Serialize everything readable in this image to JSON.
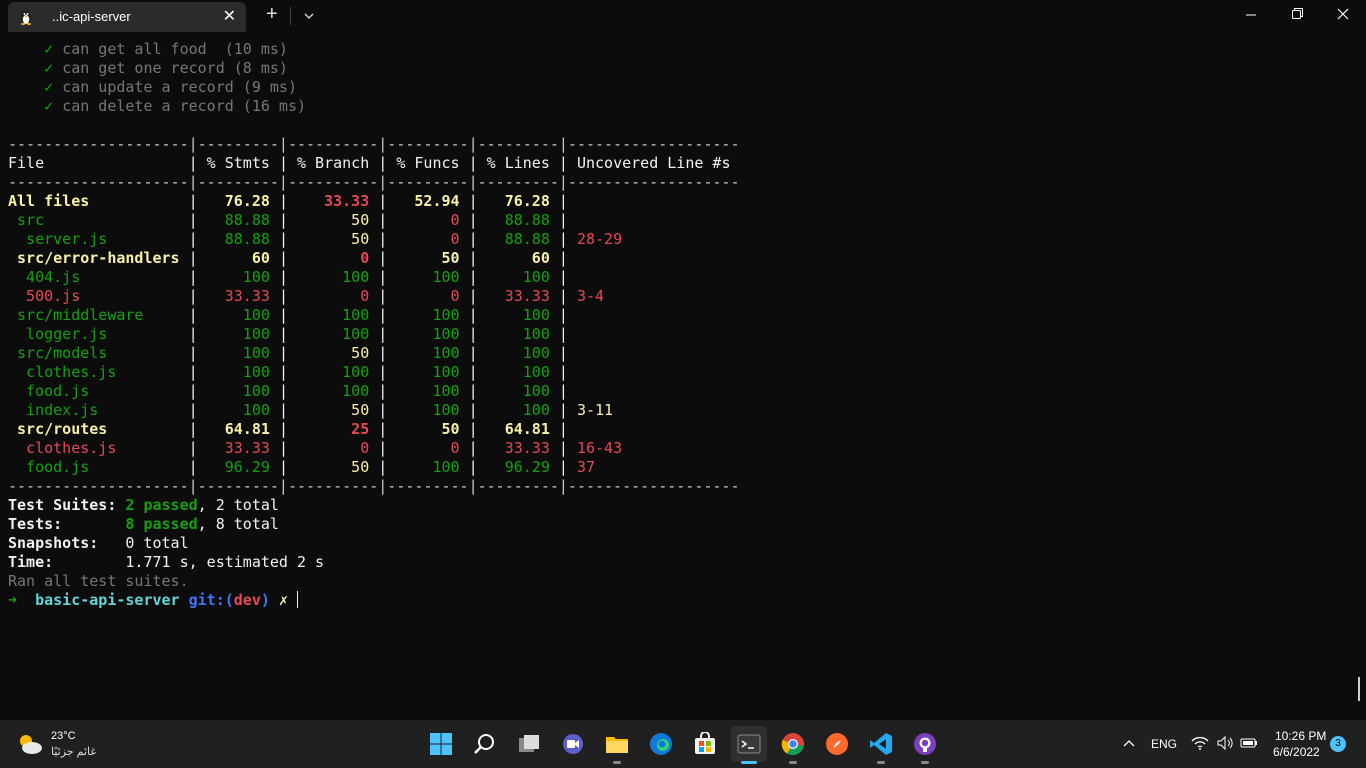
{
  "tab": {
    "title": "..ic-api-server",
    "close_glyph": "✕"
  },
  "titlebar": {
    "new_tab_glyph": "+"
  },
  "test_results": [
    {
      "mark": "✓",
      "text": "can get all food  (10 ms)"
    },
    {
      "mark": "✓",
      "text": "can get one record (8 ms)"
    },
    {
      "mark": "✓",
      "text": "can update a record (9 ms)"
    },
    {
      "mark": "✓",
      "text": "can delete a record (16 ms)"
    }
  ],
  "coverage": {
    "separator": "--------------------|---------|----------|---------|---------|-------------------",
    "headers": [
      "File",
      "% Stmts",
      "% Branch",
      "% Funcs",
      "% Lines",
      "Uncovered Line #s"
    ],
    "rows": [
      {
        "file": "All files",
        "indent": 0,
        "bold": true,
        "stmts": "76.28",
        "branch": "33.33",
        "funcs": "52.94",
        "lines": "76.28",
        "uncovered": "",
        "fc": "y",
        "sc": "y",
        "bc": "r",
        "uc": "y",
        "lc": "y",
        "ucc": "y"
      },
      {
        "file": "src",
        "indent": 1,
        "bold": false,
        "stmts": "88.88",
        "branch": "50",
        "funcs": "0",
        "lines": "88.88",
        "uncovered": "",
        "fc": "g",
        "sc": "g",
        "bc": "y",
        "uc": "r",
        "lc": "g",
        "ucc": "g"
      },
      {
        "file": "server.js",
        "indent": 2,
        "bold": false,
        "stmts": "88.88",
        "branch": "50",
        "funcs": "0",
        "lines": "88.88",
        "uncovered": "28-29",
        "fc": "g",
        "sc": "g",
        "bc": "y",
        "uc": "r",
        "lc": "g",
        "ucc": "r"
      },
      {
        "file": "src/error-handlers",
        "indent": 1,
        "bold": true,
        "stmts": "60",
        "branch": "0",
        "funcs": "50",
        "lines": "60",
        "uncovered": "",
        "fc": "y",
        "sc": "y",
        "bc": "r",
        "uc": "y",
        "lc": "y",
        "ucc": "y"
      },
      {
        "file": "404.js",
        "indent": 2,
        "bold": false,
        "stmts": "100",
        "branch": "100",
        "funcs": "100",
        "lines": "100",
        "uncovered": "",
        "fc": "g",
        "sc": "g",
        "bc": "g",
        "uc": "g",
        "lc": "g",
        "ucc": "g"
      },
      {
        "file": "500.js",
        "indent": 2,
        "bold": false,
        "stmts": "33.33",
        "branch": "0",
        "funcs": "0",
        "lines": "33.33",
        "uncovered": "3-4",
        "fc": "r",
        "sc": "r",
        "bc": "r",
        "uc": "r",
        "lc": "r",
        "ucc": "r"
      },
      {
        "file": "src/middleware",
        "indent": 1,
        "bold": false,
        "stmts": "100",
        "branch": "100",
        "funcs": "100",
        "lines": "100",
        "uncovered": "",
        "fc": "g",
        "sc": "g",
        "bc": "g",
        "uc": "g",
        "lc": "g",
        "ucc": "g"
      },
      {
        "file": "logger.js",
        "indent": 2,
        "bold": false,
        "stmts": "100",
        "branch": "100",
        "funcs": "100",
        "lines": "100",
        "uncovered": "",
        "fc": "g",
        "sc": "g",
        "bc": "g",
        "uc": "g",
        "lc": "g",
        "ucc": "g"
      },
      {
        "file": "src/models",
        "indent": 1,
        "bold": false,
        "stmts": "100",
        "branch": "50",
        "funcs": "100",
        "lines": "100",
        "uncovered": "",
        "fc": "g",
        "sc": "g",
        "bc": "y",
        "uc": "g",
        "lc": "g",
        "ucc": "g"
      },
      {
        "file": "clothes.js",
        "indent": 2,
        "bold": false,
        "stmts": "100",
        "branch": "100",
        "funcs": "100",
        "lines": "100",
        "uncovered": "",
        "fc": "g",
        "sc": "g",
        "bc": "g",
        "uc": "g",
        "lc": "g",
        "ucc": "g"
      },
      {
        "file": "food.js",
        "indent": 2,
        "bold": false,
        "stmts": "100",
        "branch": "100",
        "funcs": "100",
        "lines": "100",
        "uncovered": "",
        "fc": "g",
        "sc": "g",
        "bc": "g",
        "uc": "g",
        "lc": "g",
        "ucc": "g"
      },
      {
        "file": "index.js",
        "indent": 2,
        "bold": false,
        "stmts": "100",
        "branch": "50",
        "funcs": "100",
        "lines": "100",
        "uncovered": "3-11",
        "fc": "g",
        "sc": "g",
        "bc": "y",
        "uc": "g",
        "lc": "g",
        "ucc": "y"
      },
      {
        "file": "src/routes",
        "indent": 1,
        "bold": true,
        "stmts": "64.81",
        "branch": "25",
        "funcs": "50",
        "lines": "64.81",
        "uncovered": "",
        "fc": "y",
        "sc": "y",
        "bc": "r",
        "uc": "y",
        "lc": "y",
        "ucc": "y"
      },
      {
        "file": "clothes.js",
        "indent": 2,
        "bold": false,
        "stmts": "33.33",
        "branch": "0",
        "funcs": "0",
        "lines": "33.33",
        "uncovered": "16-43",
        "fc": "r",
        "sc": "r",
        "bc": "r",
        "uc": "r",
        "lc": "r",
        "ucc": "r"
      },
      {
        "file": "food.js",
        "indent": 2,
        "bold": false,
        "stmts": "96.29",
        "branch": "50",
        "funcs": "100",
        "lines": "96.29",
        "uncovered": "37",
        "fc": "g",
        "sc": "g",
        "bc": "y",
        "uc": "g",
        "lc": "g",
        "ucc": "r"
      }
    ]
  },
  "summary": [
    {
      "label": "Test Suites: ",
      "parts": [
        {
          "t": "2 passed",
          "c": "g"
        },
        {
          "t": ", 2 total",
          "c": "w"
        }
      ]
    },
    {
      "label": "Tests:       ",
      "parts": [
        {
          "t": "8 passed",
          "c": "g"
        },
        {
          "t": ", 8 total",
          "c": "w"
        }
      ]
    },
    {
      "label": "Snapshots:   ",
      "parts": [
        {
          "t": "0 total",
          "c": "w"
        }
      ]
    },
    {
      "label": "Time:        ",
      "parts": [
        {
          "t": "1.771 s, estimated 2 s",
          "c": "w"
        }
      ]
    }
  ],
  "ran_all": "Ran all test suites.",
  "prompt": {
    "arrow": "➜",
    "dir": "basic-api-server",
    "git": "git:(",
    "branch": "dev",
    "git_close": ")",
    "dirty": "✗"
  },
  "taskbar": {
    "temperature": "23°C",
    "condition": "غائم جزئيًا",
    "language": "ENG",
    "time": "10:26 PM",
    "date": "6/6/2022",
    "notification_count": "3",
    "apps": [
      "start",
      "search",
      "task-view",
      "teams-chat",
      "file-explorer",
      "edge",
      "store",
      "terminal",
      "chrome",
      "brave",
      "vscode",
      "github-desktop"
    ]
  },
  "colors": {
    "green": "#13a10e",
    "yellow": "#f9f1a5",
    "red": "#e74856",
    "blue": "#3b78ff",
    "accent": "#4cc2ff"
  }
}
